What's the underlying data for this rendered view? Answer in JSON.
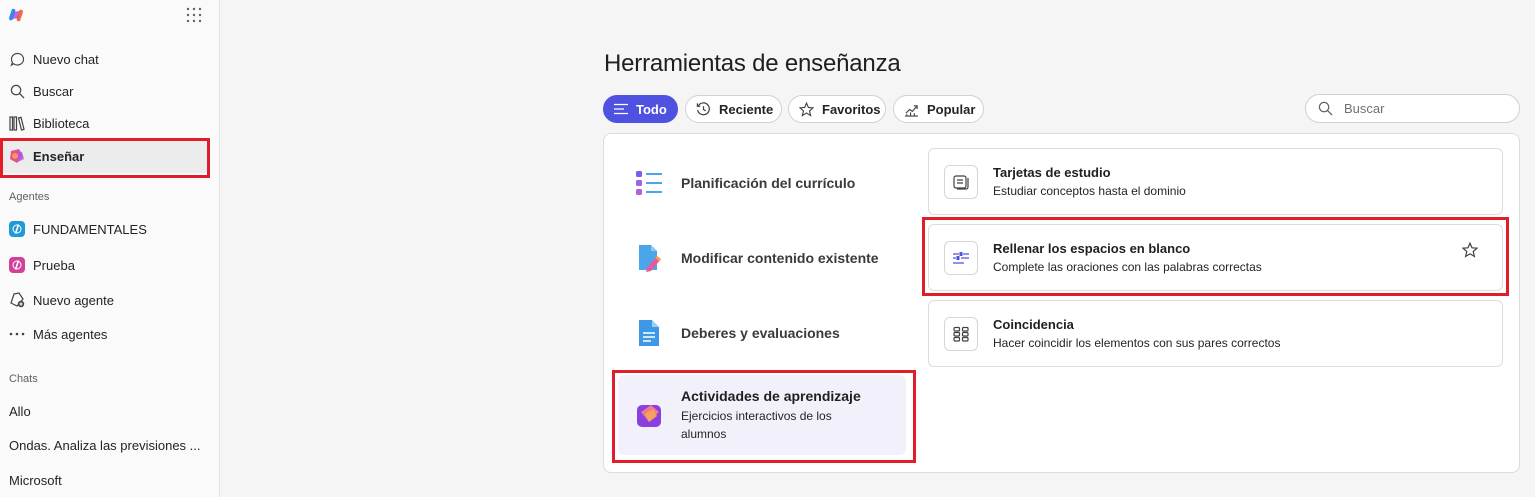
{
  "sidebar": {
    "nav": [
      {
        "label": "Nuevo chat",
        "icon": "chat-icon"
      },
      {
        "label": "Buscar",
        "icon": "search-icon"
      },
      {
        "label": "Biblioteca",
        "icon": "library-icon"
      },
      {
        "label": "Enseñar",
        "icon": "teach-icon"
      }
    ],
    "agents_heading": "Agentes",
    "agents": [
      {
        "label": "FUNDAMENTALES",
        "icon": "agent-icon"
      },
      {
        "label": "Prueba",
        "icon": "agent-icon"
      },
      {
        "label": "Nuevo agente",
        "icon": "new-agent-icon"
      },
      {
        "label": "Más agentes",
        "icon": "more-icon"
      }
    ],
    "chats_heading": "Chats",
    "chats": [
      "Allo",
      "Ondas. Analiza las previsiones ...",
      "Microsoft"
    ]
  },
  "main": {
    "title": "Herramientas de enseñanza",
    "filters": [
      {
        "label": "Todo",
        "icon": "list-icon",
        "active": true
      },
      {
        "label": "Reciente",
        "icon": "history-icon"
      },
      {
        "label": "Favoritos",
        "icon": "star-icon"
      },
      {
        "label": "Popular",
        "icon": "trending-icon"
      }
    ],
    "search_placeholder": "Buscar",
    "categories": [
      {
        "label": "Planificación del currículo"
      },
      {
        "label": "Modificar contenido existente"
      },
      {
        "label": "Deberes y evaluaciones"
      },
      {
        "label": "Actividades de aprendizaje",
        "description": "Ejercicios interactivos de los alumnos"
      }
    ],
    "cards": [
      {
        "title": "Tarjetas de estudio",
        "description": "Estudiar conceptos hasta el dominio",
        "icon": "flashcards-icon"
      },
      {
        "title": "Rellenar los espacios en blanco",
        "description": "Complete las oraciones con las palabras correctas",
        "icon": "fill-blanks-icon"
      },
      {
        "title": "Coincidencia",
        "description": "Hacer coincidir los elementos con sus pares correctos",
        "icon": "matching-icon"
      }
    ]
  },
  "colors": {
    "accent": "#4f52e0",
    "highlight": "#e01e2a"
  }
}
